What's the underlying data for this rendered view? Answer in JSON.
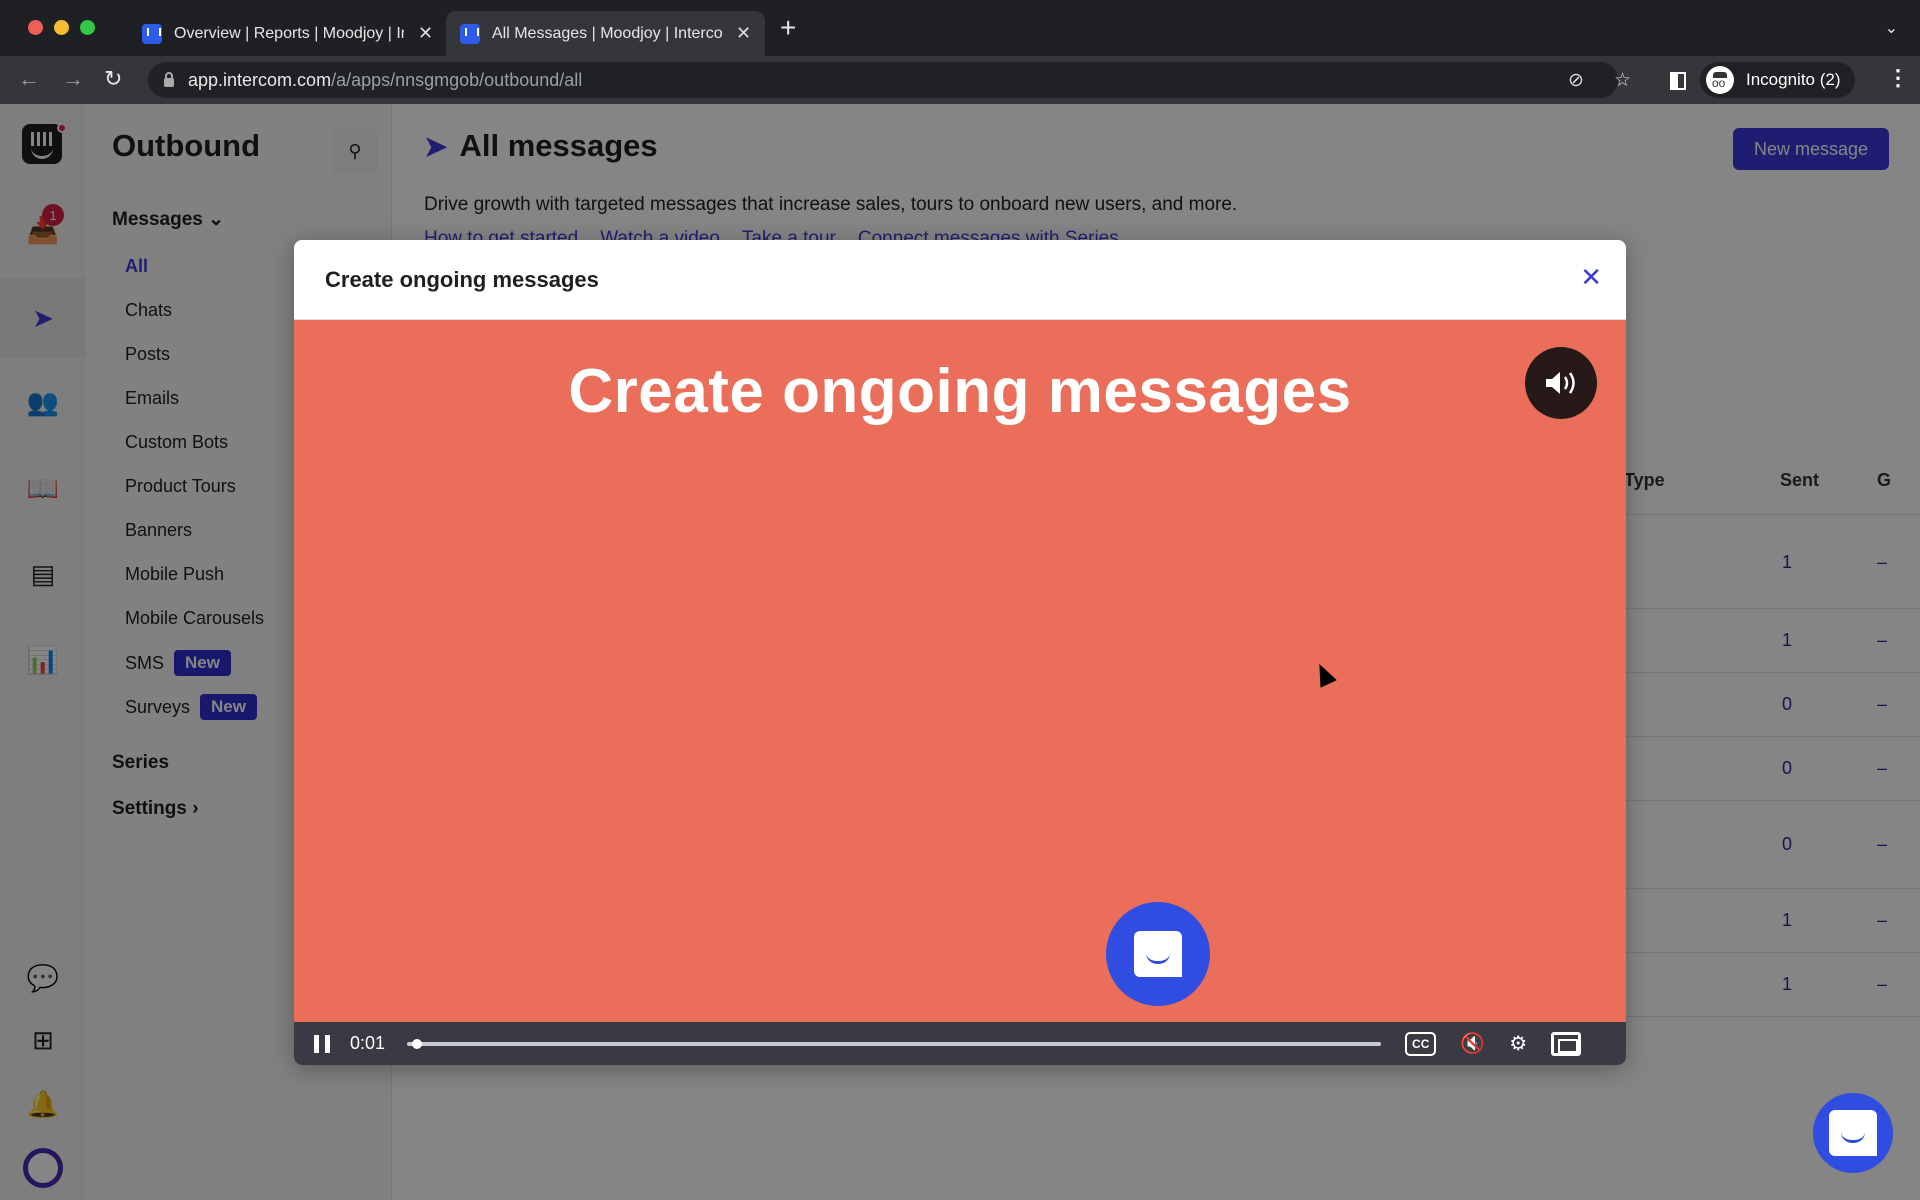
{
  "browser": {
    "tabs": [
      {
        "title": "Overview | Reports | Moodjoy | Intercom",
        "active": false
      },
      {
        "title": "All Messages | Moodjoy | Intercom",
        "active": true
      }
    ],
    "new_tab_label": "+",
    "url_host": "app.intercom.com",
    "url_path": "/a/apps/nnsgmgob/outbound/all",
    "profile_label": "Incognito (2)"
  },
  "rail": {
    "inbox_badge": "1",
    "icons": [
      "intercom-logo-icon",
      "inbox-icon",
      "outbound-icon",
      "contacts-icon",
      "articles-icon",
      "platform-icon",
      "reports-icon",
      "messenger-icon",
      "apps-icon",
      "notifications-icon",
      "profile-avatar"
    ]
  },
  "subnav": {
    "title": "Outbound",
    "messages_section": "Messages",
    "items": [
      {
        "label": "All",
        "active": true
      },
      {
        "label": "Chats"
      },
      {
        "label": "Posts"
      },
      {
        "label": "Emails"
      },
      {
        "label": "Custom Bots"
      },
      {
        "label": "Product Tours"
      },
      {
        "label": "Banners"
      },
      {
        "label": "Mobile Push"
      },
      {
        "label": "Mobile Carousels"
      },
      {
        "label": "SMS",
        "badge": "New"
      },
      {
        "label": "Surveys",
        "badge": "New"
      }
    ],
    "series_section": "Series",
    "settings_section": "Settings"
  },
  "main": {
    "title": "All messages",
    "description": "Drive growth with targeted messages that increase sales, tours to onboard new users, and more.",
    "help_links": [
      "How to get started",
      "Watch a video",
      "Take a tour",
      "Connect messages with Series"
    ],
    "new_message_label": "New message",
    "table": {
      "headers": {
        "type": "Type",
        "sent": "Sent",
        "goal": "G"
      },
      "rows": [
        {
          "sent": "1",
          "goal": "–"
        },
        {
          "sent": "1",
          "goal": "–"
        },
        {
          "sent": "0",
          "goal": "–"
        },
        {
          "sent": "0",
          "goal": "–"
        },
        {
          "sent": "0",
          "goal": "–"
        },
        {
          "sent": "1",
          "goal": "–"
        },
        {
          "sent": "1",
          "goal": "–"
        }
      ]
    }
  },
  "modal": {
    "title": "Create ongoing messages",
    "video_headline": "Create ongoing messages",
    "time": "0:01",
    "progress_percent": 0.5,
    "cc_label": "CC",
    "colors": {
      "video_bg": "#ea6e5a",
      "accent": "#3d3bd9",
      "messenger": "#2f4de0"
    }
  }
}
